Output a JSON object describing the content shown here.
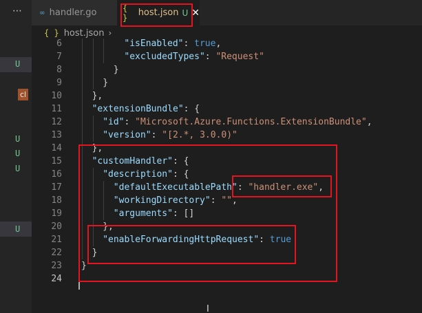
{
  "sidebar": {
    "more_icon": "ellipsis-icon",
    "badges": [
      "U",
      "U",
      "U",
      "U",
      "U"
    ],
    "c_label": "cl"
  },
  "tabs": [
    {
      "label": "handler.go",
      "icon": "go-icon",
      "icon_glyph": "∞"
    },
    {
      "label": "host.json",
      "icon": "json-icon",
      "icon_glyph": "{ }",
      "status": "U",
      "close": "✕"
    }
  ],
  "breadcrumb": {
    "icon_glyph": "{ }",
    "file": "host.json",
    "chevron": "›"
  },
  "editor": {
    "lines": [
      {
        "n": "6",
        "i": 1,
        "parts": [
          [
            "k",
            "\"isEnabled\""
          ],
          [
            "p",
            ": "
          ],
          [
            "b",
            "true"
          ],
          [
            "p",
            ","
          ]
        ]
      },
      {
        "n": "7",
        "i": 1,
        "parts": [
          [
            "k",
            "\"excludedTypes\""
          ],
          [
            "p",
            ": "
          ],
          [
            "s",
            "\"Request\""
          ]
        ]
      },
      {
        "n": "8",
        "i": 1,
        "parts": [
          [
            "p",
            "}"
          ]
        ]
      },
      {
        "n": "9",
        "i": 1,
        "parts": [
          [
            "p",
            "}"
          ]
        ]
      },
      {
        "n": "10",
        "i": 1,
        "parts": [
          [
            "p",
            "},"
          ]
        ]
      },
      {
        "n": "11",
        "i": 1,
        "parts": [
          [
            "k",
            "\"extensionBundle\""
          ],
          [
            "p",
            ": {"
          ]
        ]
      },
      {
        "n": "12",
        "i": 1,
        "parts": [
          [
            "k",
            "\"id\""
          ],
          [
            "p",
            ": "
          ],
          [
            "s",
            "\"Microsoft.Azure.Functions.ExtensionBundle\""
          ],
          [
            "p",
            ","
          ]
        ]
      },
      {
        "n": "13",
        "i": 1,
        "parts": [
          [
            "k",
            "\"version\""
          ],
          [
            "p",
            ": "
          ],
          [
            "s",
            "\"[2.*, 3.0.0)\""
          ]
        ]
      },
      {
        "n": "14",
        "i": 1,
        "parts": [
          [
            "p",
            "},"
          ]
        ]
      },
      {
        "n": "15",
        "i": 1,
        "parts": [
          [
            "k",
            "\"customHandler\""
          ],
          [
            "p",
            ": {"
          ]
        ]
      },
      {
        "n": "16",
        "i": 1,
        "parts": [
          [
            "k",
            "\"description\""
          ],
          [
            "p",
            ": {"
          ]
        ]
      },
      {
        "n": "17",
        "i": 1,
        "parts": [
          [
            "k",
            "\"defaultExecutablePath\""
          ],
          [
            "p",
            ": "
          ],
          [
            "s",
            "\"handler.exe\""
          ],
          [
            "p",
            ","
          ]
        ]
      },
      {
        "n": "18",
        "i": 1,
        "parts": [
          [
            "k",
            "\"workingDirectory\""
          ],
          [
            "p",
            ": "
          ],
          [
            "s",
            "\"\""
          ],
          [
            "p",
            ","
          ]
        ]
      },
      {
        "n": "19",
        "i": 1,
        "parts": [
          [
            "k",
            "\"arguments\""
          ],
          [
            "p",
            ": []"
          ]
        ]
      },
      {
        "n": "20",
        "i": 1,
        "parts": [
          [
            "p",
            "},"
          ]
        ]
      },
      {
        "n": "21",
        "i": 1,
        "parts": [
          [
            "k",
            "\"enableForwardingHttpRequest\""
          ],
          [
            "p",
            ": "
          ],
          [
            "b",
            "true"
          ]
        ]
      },
      {
        "n": "22",
        "i": 1,
        "parts": [
          [
            "p",
            "}"
          ]
        ]
      },
      {
        "n": "23",
        "i": 0,
        "parts": [
          [
            "p",
            "}"
          ]
        ]
      },
      {
        "n": "24",
        "i": 0,
        "parts": []
      }
    ],
    "current_line": "24"
  },
  "colors": {
    "background": "#1e1e1e",
    "json_key": "#9cdcfe",
    "json_string": "#ce9178",
    "json_boolean": "#569cd6",
    "annotation": "#e51421",
    "untracked": "#73c991"
  }
}
